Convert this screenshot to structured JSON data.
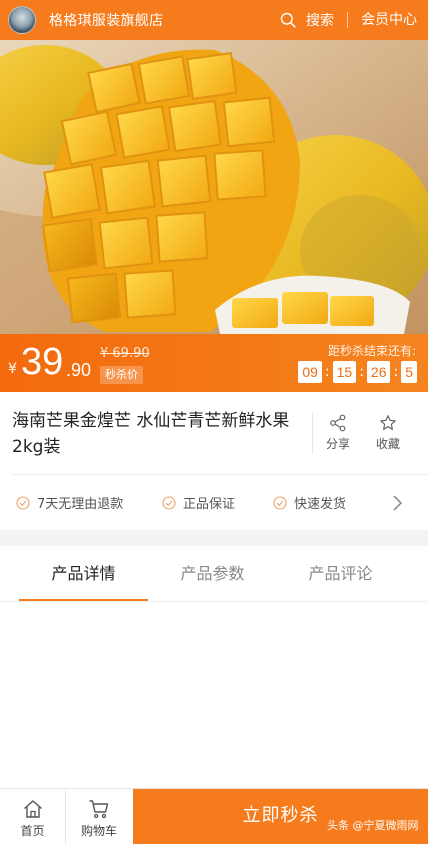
{
  "header": {
    "shop_name": "格格琪服装旗舰店",
    "search_label": "搜索",
    "member_label": "会员中心",
    "icons": {
      "avatar": "shop-avatar",
      "search": "search-icon"
    },
    "background": "#f57b1c"
  },
  "hero": {
    "subject": "mango-product-photo"
  },
  "price": {
    "currency": "¥",
    "integer": "39",
    "decimal": ".90",
    "original": "¥ 69.90",
    "tag": "秒杀价",
    "countdown_label": "距秒杀结束还有:",
    "countdown": {
      "hours": "09",
      "minutes": "15",
      "seconds": "26",
      "tenths": "5"
    },
    "separator": ":"
  },
  "product": {
    "title": "海南芒果金煌芒 水仙芒青芒新鲜水果 2kg装",
    "share_label": "分享",
    "favorite_label": "收藏"
  },
  "guarantees": {
    "items": [
      "7天无理由退款",
      "正品保证",
      "快速发货"
    ]
  },
  "tabs": {
    "items": [
      "产品详情",
      "产品参数",
      "产品评论"
    ],
    "active_index": 0
  },
  "bottom_bar": {
    "home_label": "首页",
    "cart_label": "购物车",
    "buy_label": "立即秒杀",
    "watermark": "头条 @宁夏微雨网"
  },
  "colors": {
    "accent": "#f57b1c",
    "price_gradient_start": "#f36a0d",
    "countdown_text": "#f26a10"
  }
}
